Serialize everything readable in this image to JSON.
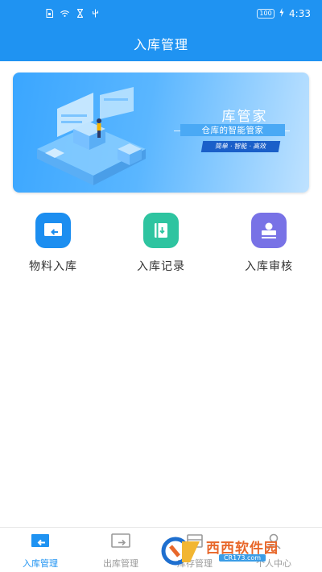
{
  "status_bar": {
    "battery": "100",
    "time": "4:33",
    "icons": [
      "sim-icon",
      "wifi-icon",
      "hourglass-icon",
      "usb-icon",
      "charging-icon"
    ]
  },
  "header": {
    "title": "入库管理",
    "color": "#1f93f2"
  },
  "banner": {
    "title": "库管家",
    "subtitle": "仓库的智能管家",
    "tags": "简单 · 智能 · 高效"
  },
  "features": [
    {
      "label": "物料入库",
      "icon": "inbound-screen-icon",
      "color": "#1c8ef0"
    },
    {
      "label": "入库记录",
      "icon": "record-book-icon",
      "color": "#2ec4a0"
    },
    {
      "label": "入库审核",
      "icon": "stamp-icon",
      "color": "#7872e6"
    }
  ],
  "tabbar": {
    "items": [
      {
        "label": "入库管理",
        "icon": "inbound-screen-icon",
        "active": true
      },
      {
        "label": "出库管理",
        "icon": "outbound-screen-icon",
        "active": false
      },
      {
        "label": "库存管理",
        "icon": "inventory-icon",
        "active": false
      },
      {
        "label": "个人中心",
        "icon": "user-icon",
        "active": false
      }
    ],
    "active_color": "#1f93f2",
    "inactive_color": "#9a9a9a"
  },
  "watermark": {
    "text": "西西软件园",
    "url": "CR173.com"
  }
}
